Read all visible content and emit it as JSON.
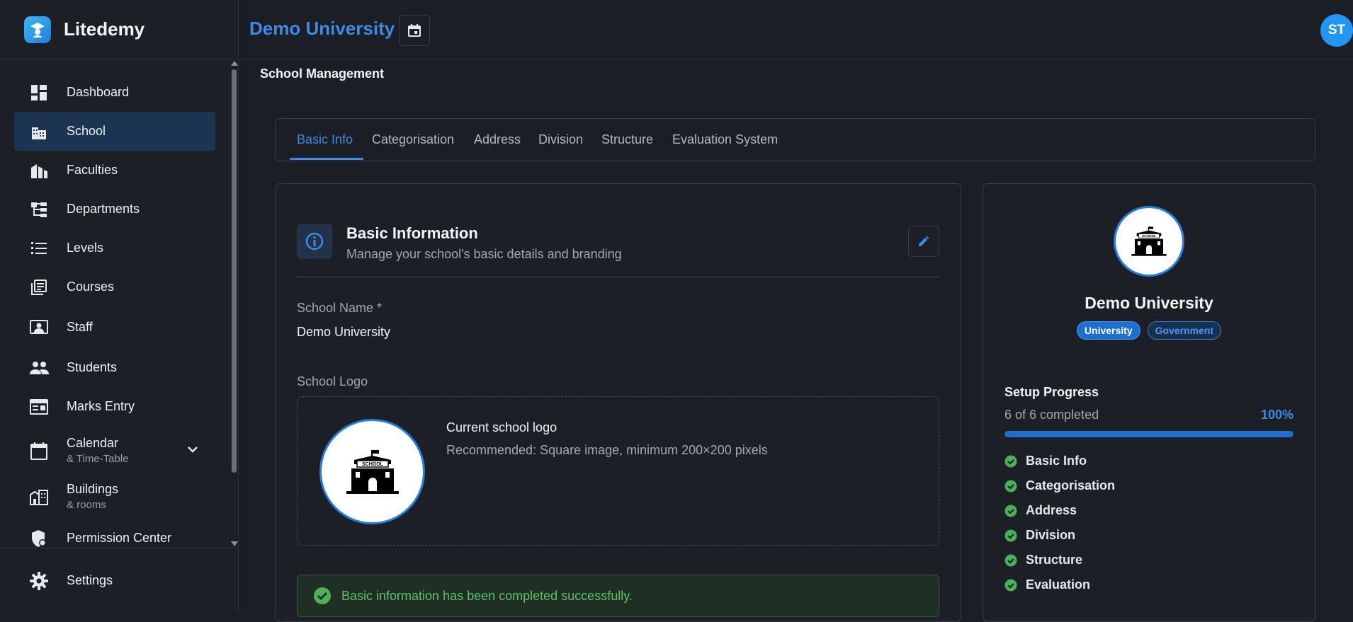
{
  "app": {
    "name": "Litedemy"
  },
  "header": {
    "title": "Demo University",
    "avatar_initials": "ST"
  },
  "sidebar": {
    "items": [
      {
        "label": "Dashboard",
        "icon": "dashboard-icon"
      },
      {
        "label": "School",
        "icon": "school-icon",
        "active": true
      },
      {
        "label": "Faculties",
        "icon": "faculties-icon"
      },
      {
        "label": "Departments",
        "icon": "departments-icon"
      },
      {
        "label": "Levels",
        "icon": "levels-icon"
      },
      {
        "label": "Courses",
        "icon": "courses-icon"
      },
      {
        "label": "Staff",
        "icon": "staff-icon"
      },
      {
        "label": "Students",
        "icon": "students-icon"
      },
      {
        "label": "Marks Entry",
        "icon": "marks-entry-icon"
      },
      {
        "label": "Calendar",
        "sublabel": "& Time-Table",
        "icon": "calendar-icon"
      },
      {
        "label": "Buildings",
        "sublabel": "& rooms",
        "icon": "buildings-icon"
      },
      {
        "label": "Permission Center",
        "icon": "shield-icon"
      }
    ],
    "settings_label": "Settings"
  },
  "page": {
    "heading": "School Management"
  },
  "tabs": [
    "Basic Info",
    "Categorisation",
    "Address",
    "Division",
    "Structure",
    "Evaluation System"
  ],
  "basic_info": {
    "title": "Basic Information",
    "subtitle": "Manage your school's basic details and branding",
    "school_name_label": "School Name *",
    "school_name_value": "Demo University",
    "logo_label": "School Logo",
    "logo_current": "Current school logo",
    "logo_hint": "Recommended: Square image, minimum 200×200 pixels",
    "logo_image_text": "SCHOOL",
    "success_message": "Basic information has been completed successfully."
  },
  "summary": {
    "name": "Demo University",
    "chips": [
      "University",
      "Government"
    ],
    "setup_title": "Setup Progress",
    "completed_text": "6 of 6 completed",
    "percent_text": "100%",
    "progress_fraction": 1.0,
    "steps": [
      "Basic Info",
      "Categorisation",
      "Address",
      "Division",
      "Structure",
      "Evaluation"
    ]
  },
  "colors": {
    "accent": "#3f8ae6",
    "success": "#5dc06a",
    "active_nav": "#1a3452"
  }
}
